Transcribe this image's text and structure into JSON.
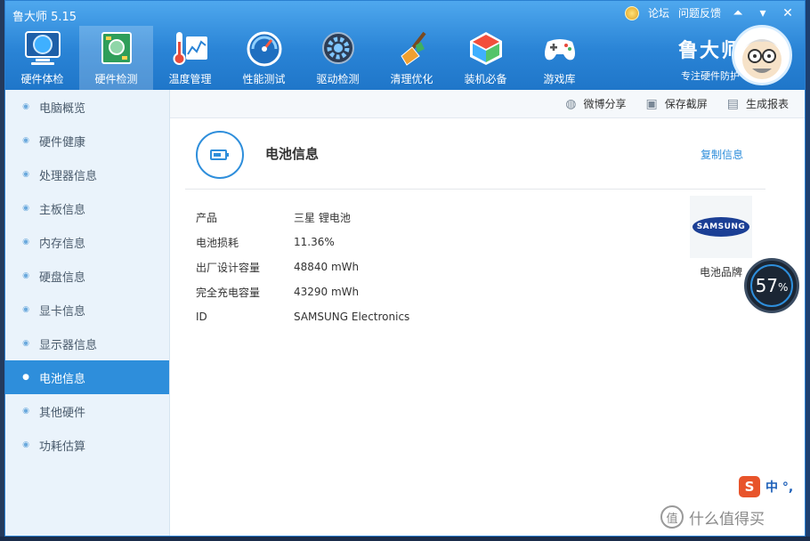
{
  "app": {
    "title": "鲁大师 5.15"
  },
  "top_links": {
    "forum": "论坛",
    "feedback": "问题反馈"
  },
  "window_controls": {
    "skin": "⏶",
    "menu": "▾",
    "close": "✕"
  },
  "toolbar": [
    {
      "label": "硬件体检",
      "icon": "monitor-check-icon"
    },
    {
      "label": "硬件检测",
      "icon": "circuit-board-icon"
    },
    {
      "label": "温度管理",
      "icon": "thermometer-chart-icon"
    },
    {
      "label": "性能测试",
      "icon": "speedometer-icon"
    },
    {
      "label": "驱动检测",
      "icon": "gear-icon"
    },
    {
      "label": "清理优化",
      "icon": "broom-icon"
    },
    {
      "label": "装机必备",
      "icon": "cube-icon"
    },
    {
      "label": "游戏库",
      "icon": "gamepad-icon"
    }
  ],
  "brand": {
    "name": "鲁大师",
    "slogan": "专注硬件防护"
  },
  "sidebar": {
    "items": [
      {
        "label": "电脑概览"
      },
      {
        "label": "硬件健康"
      },
      {
        "label": "处理器信息"
      },
      {
        "label": "主板信息"
      },
      {
        "label": "内存信息"
      },
      {
        "label": "硬盘信息"
      },
      {
        "label": "显卡信息"
      },
      {
        "label": "显示器信息"
      },
      {
        "label": "电池信息"
      },
      {
        "label": "其他硬件"
      },
      {
        "label": "功耗估算"
      }
    ],
    "active_index": 8
  },
  "actionbar": {
    "share": "微博分享",
    "screenshot": "保存截屏",
    "report": "生成报表"
  },
  "page": {
    "title": "电池信息",
    "copy": "复制信息",
    "rows": [
      {
        "key": "产品",
        "value": "三星 锂电池"
      },
      {
        "key": "电池损耗",
        "value": "11.36%"
      },
      {
        "key": "出厂设计容量",
        "value": "48840 mWh"
      },
      {
        "key": "完全充电容量",
        "value": "43290 mWh"
      },
      {
        "key": "ID",
        "value": "SAMSUNG Electronics"
      }
    ],
    "brand_logo_text": "SAMSUNG",
    "brand_caption": "电池品牌"
  },
  "meter": {
    "value": "57",
    "unit": "%"
  },
  "ime": {
    "logo": "S",
    "text": "中 °,"
  },
  "watermark": {
    "icon": "值",
    "text": "什么值得买"
  },
  "colors": {
    "accent": "#2e8edb",
    "titlebar": "#2a84d6",
    "sidebar_bg": "#eaf3fb"
  }
}
